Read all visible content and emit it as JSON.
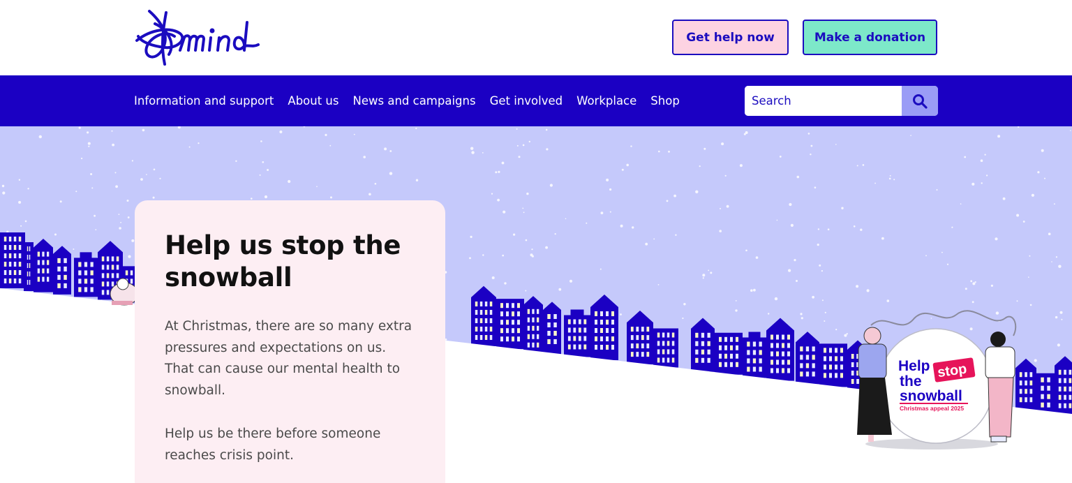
{
  "header": {
    "logo_text": "mind",
    "get_help_label": "Get help now",
    "donate_label": "Make a donation"
  },
  "nav": {
    "items": [
      {
        "label": "Information and support"
      },
      {
        "label": "About us"
      },
      {
        "label": "News and campaigns"
      },
      {
        "label": "Get involved"
      },
      {
        "label": "Workplace"
      },
      {
        "label": "Shop"
      }
    ],
    "search_placeholder": "Search",
    "search_icon": "search-icon"
  },
  "hero": {
    "title": "Help us stop the snowball",
    "paragraph_1": "At Christmas, there are so many extra pressures and expectations on us. That can cause our mental health to snowball.",
    "paragraph_2": "Help us be there before someone reaches crisis point.",
    "snowball_badge": {
      "line1": "Help",
      "line_stop": "stop",
      "line2": "the",
      "line3": "snowball",
      "subline": "Christmas appeal 2025"
    }
  },
  "colors": {
    "brand_blue": "#1b00c3",
    "sky": "#c5c9fb",
    "card_pink": "#fdeef3",
    "help_button": "#fdd3e2",
    "donate_button": "#7de8c9",
    "accent_pink": "#e6145a"
  }
}
